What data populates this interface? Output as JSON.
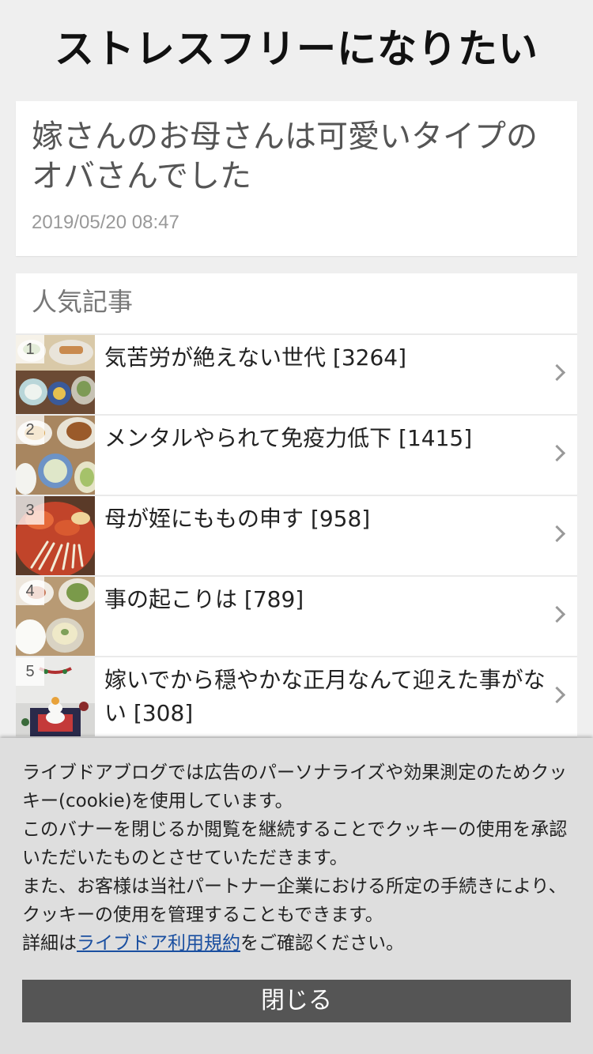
{
  "blog": {
    "title": "ストレスフリーになりたい"
  },
  "article": {
    "title": "嫁さんのお母さんは可愛いタイプのオバさんでした",
    "date": "2019/05/20 08:47"
  },
  "popular": {
    "heading": "人気記事",
    "items": [
      {
        "rank": "1",
        "label": "気苦労が絶えない世代 [3264]"
      },
      {
        "rank": "2",
        "label": "メンタルやられて免疫力低下 [1415]"
      },
      {
        "rank": "3",
        "label": "母が姪にももの申す [958]"
      },
      {
        "rank": "4",
        "label": "事の起こりは [789]"
      },
      {
        "rank": "5",
        "label": "嫁いでから穏やかな正月なんて迎えた事がない [308]"
      }
    ]
  },
  "cookie_banner": {
    "line1": "ライブドアブログでは広告のパーソナライズや効果測定のためクッキー(cookie)を使用しています。",
    "line2": "このバナーを閉じるか閲覧を継続することでクッキーの使用を承認いただいたものとさせていただきます。",
    "line3": "また、お客様は当社パートナー企業における所定の手続きにより、クッキーの使用を管理することもできます。",
    "details_prefix": "詳細は",
    "terms_link": "ライブドア利用規約",
    "details_suffix": "をご確認ください。",
    "close_label": "閉じる"
  },
  "colors": {
    "background": "#efefef",
    "link": "#1a4fa0",
    "close_button": "#555555"
  }
}
